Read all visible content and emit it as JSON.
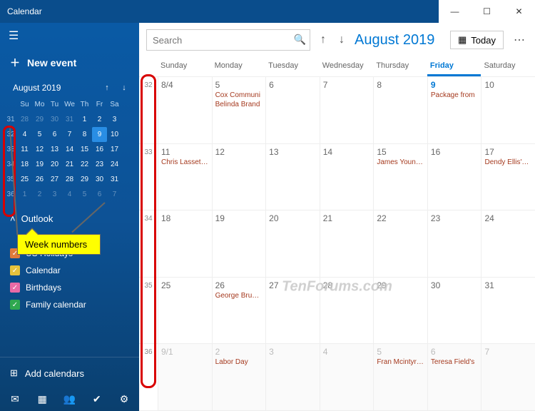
{
  "window": {
    "title": "Calendar"
  },
  "sidebar": {
    "newEvent": "New event",
    "miniHeader": "August 2019",
    "dayNames": [
      "Su",
      "Mo",
      "Tu",
      "We",
      "Th",
      "Fr",
      "Sa"
    ],
    "miniRows": [
      {
        "wk": "31",
        "days": [
          {
            "n": "28",
            "o": true
          },
          {
            "n": "29",
            "o": true
          },
          {
            "n": "30",
            "o": true
          },
          {
            "n": "31",
            "o": true
          },
          {
            "n": "1"
          },
          {
            "n": "2"
          },
          {
            "n": "3"
          }
        ]
      },
      {
        "wk": "32",
        "days": [
          {
            "n": "4"
          },
          {
            "n": "5"
          },
          {
            "n": "6"
          },
          {
            "n": "7"
          },
          {
            "n": "8"
          },
          {
            "n": "9",
            "t": true
          },
          {
            "n": "10"
          }
        ]
      },
      {
        "wk": "33",
        "days": [
          {
            "n": "11"
          },
          {
            "n": "12"
          },
          {
            "n": "13"
          },
          {
            "n": "14"
          },
          {
            "n": "15"
          },
          {
            "n": "16"
          },
          {
            "n": "17"
          }
        ]
      },
      {
        "wk": "34",
        "days": [
          {
            "n": "18"
          },
          {
            "n": "19"
          },
          {
            "n": "20"
          },
          {
            "n": "21"
          },
          {
            "n": "22"
          },
          {
            "n": "23"
          },
          {
            "n": "24"
          }
        ]
      },
      {
        "wk": "35",
        "days": [
          {
            "n": "25"
          },
          {
            "n": "26"
          },
          {
            "n": "27"
          },
          {
            "n": "28"
          },
          {
            "n": "29"
          },
          {
            "n": "30"
          },
          {
            "n": "31"
          }
        ]
      },
      {
        "wk": "36",
        "days": [
          {
            "n": "1",
            "o": true
          },
          {
            "n": "2",
            "o": true
          },
          {
            "n": "3",
            "o": true
          },
          {
            "n": "4",
            "o": true
          },
          {
            "n": "5",
            "o": true
          },
          {
            "n": "6",
            "o": true
          },
          {
            "n": "7",
            "o": true
          }
        ]
      }
    ],
    "account": "Outlook",
    "callout": "Week numbers",
    "calendars": [
      {
        "label": "US Holidays",
        "color": "#e07a3b"
      },
      {
        "label": "Calendar",
        "color": "#e6c23c"
      },
      {
        "label": "Birthdays",
        "color": "#e86aa6"
      },
      {
        "label": "Family calendar",
        "color": "#2fa84f"
      }
    ],
    "addCalendars": "Add calendars"
  },
  "toolbar": {
    "searchPlaceholder": "Search",
    "monthLabel": "August 2019",
    "todayLabel": "Today"
  },
  "grid": {
    "dayHeaders": [
      "Sunday",
      "Monday",
      "Tuesday",
      "Wednesday",
      "Thursday",
      "Friday",
      "Saturday"
    ],
    "todayIndex": 5,
    "weeks": [
      {
        "wk": "32",
        "days": [
          {
            "n": "8/4"
          },
          {
            "n": "5",
            "ev": [
              "Cox Communi",
              "Belinda Brand"
            ]
          },
          {
            "n": "6"
          },
          {
            "n": "7"
          },
          {
            "n": "8"
          },
          {
            "n": "9",
            "t": true,
            "ev": [
              "Package from "
            ]
          },
          {
            "n": "10"
          }
        ]
      },
      {
        "wk": "33",
        "days": [
          {
            "n": "11",
            "ev": [
              "Chris Lassetter"
            ]
          },
          {
            "n": "12"
          },
          {
            "n": "13"
          },
          {
            "n": "14"
          },
          {
            "n": "15",
            "ev": [
              "James Young's"
            ]
          },
          {
            "n": "16"
          },
          {
            "n": "17",
            "ev": [
              "Dendy Ellis's bi"
            ]
          }
        ]
      },
      {
        "wk": "34",
        "days": [
          {
            "n": "18"
          },
          {
            "n": "19"
          },
          {
            "n": "20"
          },
          {
            "n": "21"
          },
          {
            "n": "22"
          },
          {
            "n": "23"
          },
          {
            "n": "24"
          }
        ]
      },
      {
        "wk": "35",
        "days": [
          {
            "n": "25"
          },
          {
            "n": "26",
            "ev": [
              "George Brunsc"
            ]
          },
          {
            "n": "27"
          },
          {
            "n": "28"
          },
          {
            "n": "29"
          },
          {
            "n": "30"
          },
          {
            "n": "31"
          }
        ]
      },
      {
        "wk": "36",
        "days": [
          {
            "n": "9/1",
            "o": true
          },
          {
            "n": "2",
            "o": true,
            "ev": [
              "Labor Day"
            ]
          },
          {
            "n": "3",
            "o": true
          },
          {
            "n": "4",
            "o": true
          },
          {
            "n": "5",
            "o": true,
            "ev": [
              "Fran Mcintyre's"
            ]
          },
          {
            "n": "6",
            "o": true,
            "ev": [
              "Teresa Field's"
            ]
          },
          {
            "n": "7",
            "o": true
          }
        ]
      }
    ]
  },
  "watermark": "TenForums.com"
}
